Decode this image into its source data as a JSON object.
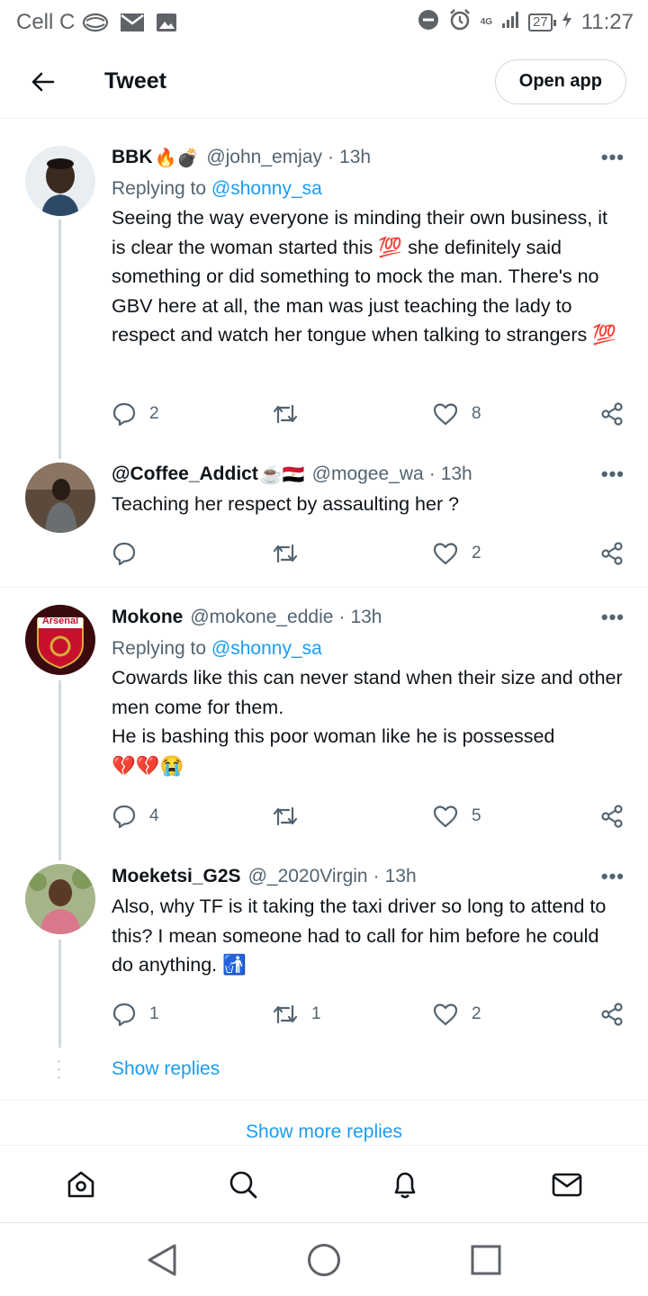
{
  "status_bar": {
    "carrier": "Cell C",
    "network": "4G",
    "battery": "27",
    "time": "11:27"
  },
  "header": {
    "title": "Tweet",
    "open_app_label": "Open app"
  },
  "tweets": [
    {
      "name": "BBK",
      "name_emoji": "🔥💣",
      "handle": "@john_emjay",
      "time": "13h",
      "replying_prefix": "Replying to",
      "replying_to": "@shonny_sa",
      "body": "Seeing the way everyone is minding their own business, it is clear the woman started this 💯 she definitely said something or did something to mock the man. There's no GBV here at all, the man was just teaching the lady to respect and watch her tongue when talking to strangers 💯",
      "replies": "2",
      "retweets": "",
      "likes": "8"
    },
    {
      "name": "@Coffee_Addict",
      "name_emoji": "☕🇪🇬",
      "handle": "@mogee_wa",
      "time": "13h",
      "body": "Teaching her respect by assaulting her ?",
      "replies": "",
      "retweets": "",
      "likes": "2"
    },
    {
      "name": "Mokone",
      "name_emoji": "",
      "handle": "@mokone_eddie",
      "time": "13h",
      "replying_prefix": "Replying to",
      "replying_to": "@shonny_sa",
      "avatar_text": "Arsenal",
      "body": "Cowards like this can never stand when their size and other men come for them.\nHe is bashing this poor woman like he is possessed\n💔💔😭",
      "replies": "4",
      "retweets": "",
      "likes": "5"
    },
    {
      "name": "Moeketsi_G2S",
      "name_emoji": "",
      "handle": "@_2020Virgin",
      "time": "13h",
      "body": "Also, why TF is it taking the taxi driver so long to attend to this? I mean someone had to call for him before he could do anything. 🚮",
      "replies": "1",
      "retweets": "1",
      "likes": "2"
    }
  ],
  "show_replies_label": "Show replies",
  "show_more_replies_label": "Show more replies",
  "bottom_nav": [
    "home-icon",
    "search-icon",
    "notifications-icon",
    "messages-icon"
  ],
  "colors": {
    "accent": "#1d9bf0",
    "text": "#0f1419",
    "secondary": "#536471",
    "divider": "#eff3f4"
  }
}
